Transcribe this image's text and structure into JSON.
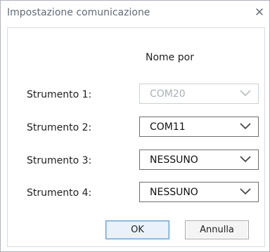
{
  "window": {
    "title": "Impostazione comunicazione",
    "close_symbol": "✕"
  },
  "header": {
    "port_column": "Nome por"
  },
  "instruments": [
    {
      "label": "Strumento 1:",
      "value": "COM20",
      "enabled": false
    },
    {
      "label": "Strumento 2:",
      "value": "COM11",
      "enabled": true
    },
    {
      "label": "Strumento 3:",
      "value": "NESSUNO",
      "enabled": true
    },
    {
      "label": "Strumento 4:",
      "value": "NESSUNO",
      "enabled": true
    }
  ],
  "buttons": {
    "ok": "OK",
    "cancel": "Annulla"
  },
  "icons": {
    "close": "close-icon",
    "dropdown": "chevron-down-icon"
  },
  "colors": {
    "ok_border": "#5c9bd8",
    "disabled_text": "#a9b1b8"
  }
}
